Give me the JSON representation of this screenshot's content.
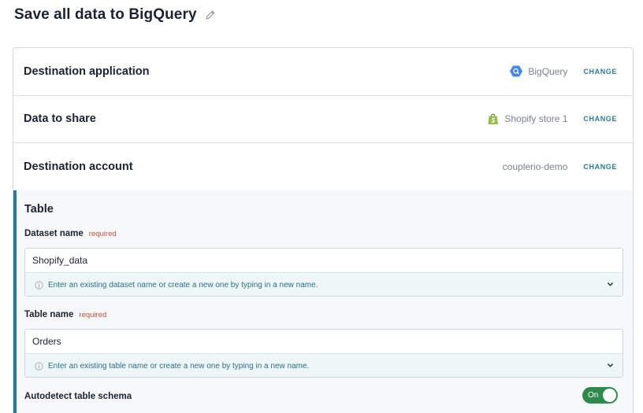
{
  "page": {
    "title": "Save all data to BigQuery",
    "edit_icon": "pencil-icon"
  },
  "steps": [
    {
      "title": "Destination application",
      "value": "BigQuery",
      "value_icon": "bigquery-icon",
      "change_label": "CHANGE"
    },
    {
      "title": "Data to share",
      "value": "Shopify store 1",
      "value_icon": "shopify-icon",
      "change_label": "CHANGE"
    },
    {
      "title": "Destination account",
      "value": "couplerio-demo",
      "change_label": "CHANGE"
    }
  ],
  "table_section": {
    "title": "Table",
    "dataset": {
      "label": "Dataset name",
      "required": "required",
      "value": "Shopify_data",
      "hint": "Enter an existing dataset name or create a new one by typing in a new name."
    },
    "table": {
      "label": "Table name",
      "required": "required",
      "value": "Orders",
      "hint": "Enter an existing table name or create a new one by typing in a new name."
    },
    "autodetect": {
      "label": "Autodetect table schema",
      "state": "On"
    }
  },
  "colors": {
    "accent": "#2c7a96",
    "toggle_on": "#2e8a4a",
    "required": "#c0503a",
    "bigquery": "#4386f0",
    "shopify": "#95bf47"
  }
}
